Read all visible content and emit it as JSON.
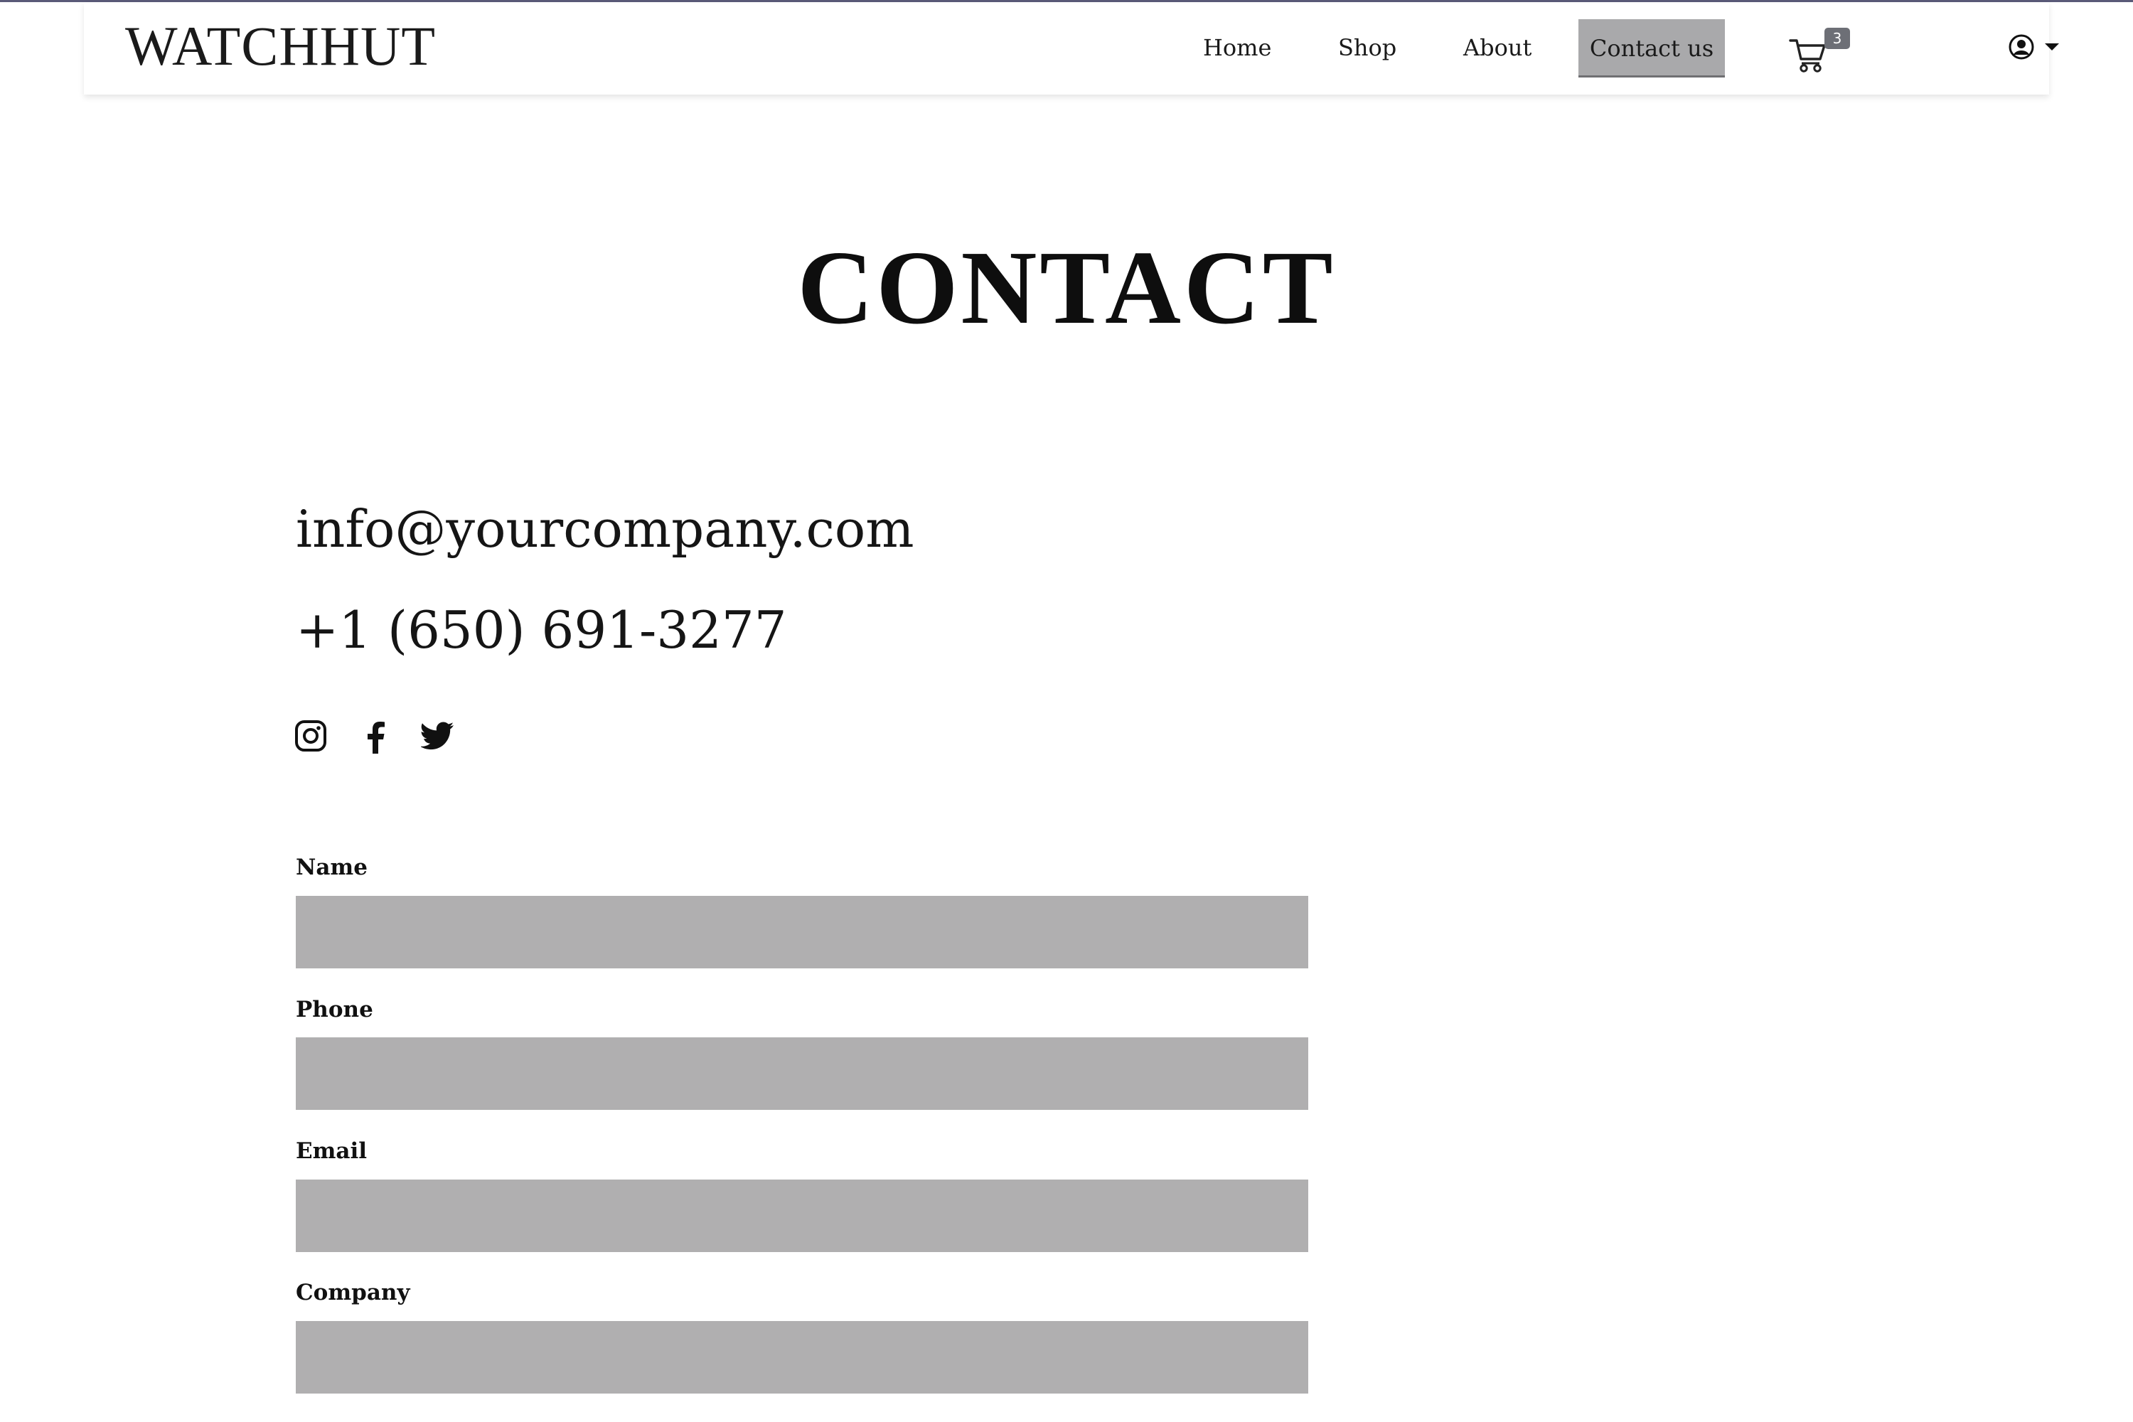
{
  "brand": {
    "logo_text": "WATCHHUT"
  },
  "nav": {
    "items": [
      {
        "label": "Home",
        "active": false
      },
      {
        "label": "Shop",
        "active": false
      },
      {
        "label": "About",
        "active": false
      },
      {
        "label": "Contact us",
        "active": true
      }
    ],
    "cart": {
      "icon": "cart-icon",
      "count": "3"
    },
    "user": {
      "icon": "user-circle-icon",
      "dropdown_icon": "caret-down-icon"
    }
  },
  "page": {
    "title": "CONTACT"
  },
  "contact": {
    "email": "info@yourcompany.com",
    "phone": "+1 (650) 691-3277"
  },
  "social": [
    {
      "name": "instagram",
      "icon": "instagram-icon"
    },
    {
      "name": "facebook",
      "icon": "facebook-icon"
    },
    {
      "name": "twitter",
      "icon": "twitter-icon"
    }
  ],
  "form": {
    "fields": [
      {
        "label": "Name",
        "value": "",
        "placeholder": ""
      },
      {
        "label": "Phone",
        "value": "",
        "placeholder": ""
      },
      {
        "label": "Email",
        "value": "",
        "placeholder": ""
      },
      {
        "label": "Company",
        "value": "",
        "placeholder": ""
      }
    ]
  },
  "colors": {
    "active_nav_bg": "#a9a9ab",
    "input_bg": "#b0afb0",
    "badge_bg": "#6d6f76",
    "text": "#111111"
  }
}
